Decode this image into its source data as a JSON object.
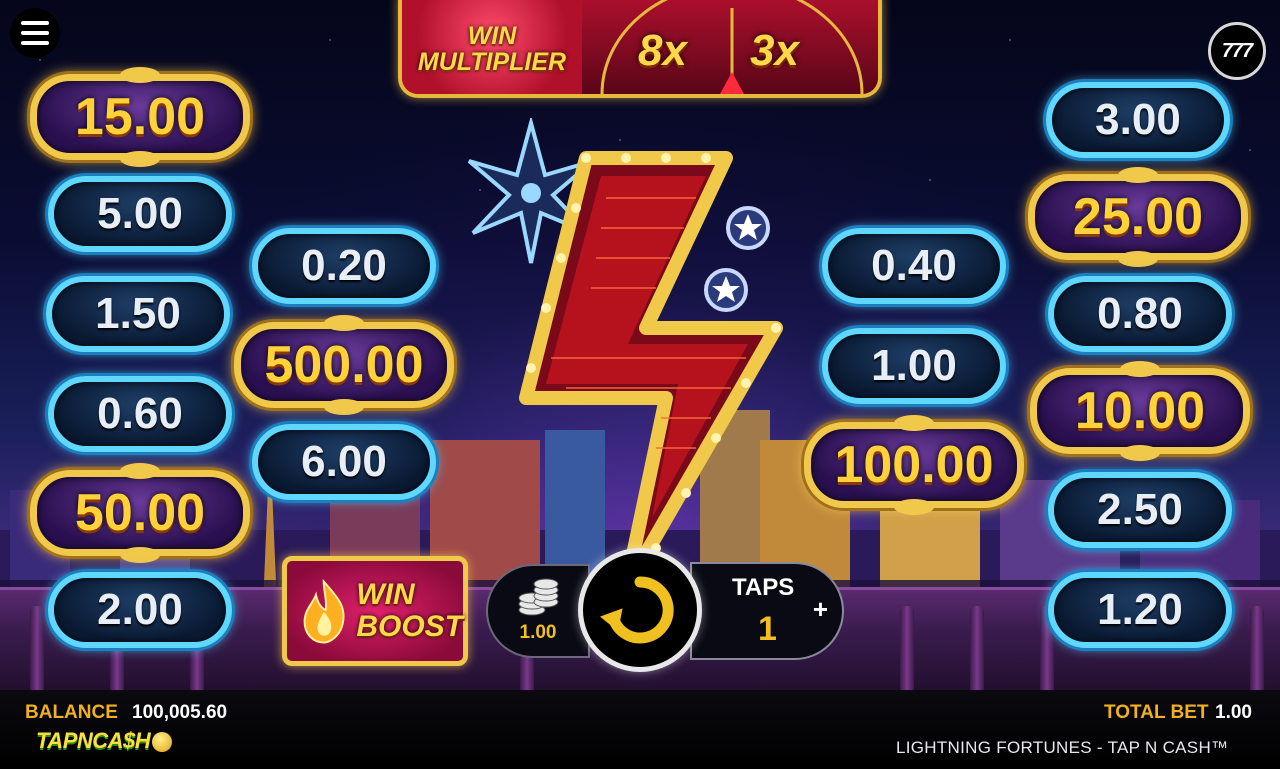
{
  "game": {
    "title": "LIGHTNING FORTUNES - TAP N CASH™",
    "brand": "TAPNCA$H",
    "top_right_badge": "777"
  },
  "win_multiplier": {
    "label_line1": "WIN",
    "label_line2": "MULTIPLIER",
    "values": [
      "8x",
      "3x"
    ]
  },
  "prizes": {
    "left_col1": [
      {
        "value": "15.00",
        "style": "gold"
      },
      {
        "value": "5.00",
        "style": "blue"
      },
      {
        "value": "1.50",
        "style": "blue"
      },
      {
        "value": "0.60",
        "style": "blue"
      },
      {
        "value": "50.00",
        "style": "gold"
      },
      {
        "value": "2.00",
        "style": "blue"
      }
    ],
    "left_col2": [
      {
        "value": "0.20",
        "style": "blue"
      },
      {
        "value": "500.00",
        "style": "gold"
      },
      {
        "value": "6.00",
        "style": "blue"
      }
    ],
    "right_col1": [
      {
        "value": "0.40",
        "style": "blue"
      },
      {
        "value": "1.00",
        "style": "blue"
      },
      {
        "value": "100.00",
        "style": "gold"
      }
    ],
    "right_col2": [
      {
        "value": "3.00",
        "style": "blue"
      },
      {
        "value": "25.00",
        "style": "gold"
      },
      {
        "value": "0.80",
        "style": "blue"
      },
      {
        "value": "10.00",
        "style": "gold"
      },
      {
        "value": "2.50",
        "style": "blue"
      },
      {
        "value": "1.20",
        "style": "blue"
      }
    ]
  },
  "controls": {
    "win_boost_line1": "WIN",
    "win_boost_line2": "BOOST",
    "bet_value": "1.00",
    "taps_label": "TAPS",
    "taps_count": "1",
    "taps_plus": "+"
  },
  "footer": {
    "balance_label": "BALANCE",
    "balance_value": "100,005.60",
    "total_bet_label": "TOTAL BET",
    "total_bet_value": "1.00"
  },
  "colors": {
    "gold": "#f0c84a",
    "blue_glow": "#5fd7ff",
    "label_orange": "#f0b020",
    "boost_pink": "#e0206a"
  }
}
